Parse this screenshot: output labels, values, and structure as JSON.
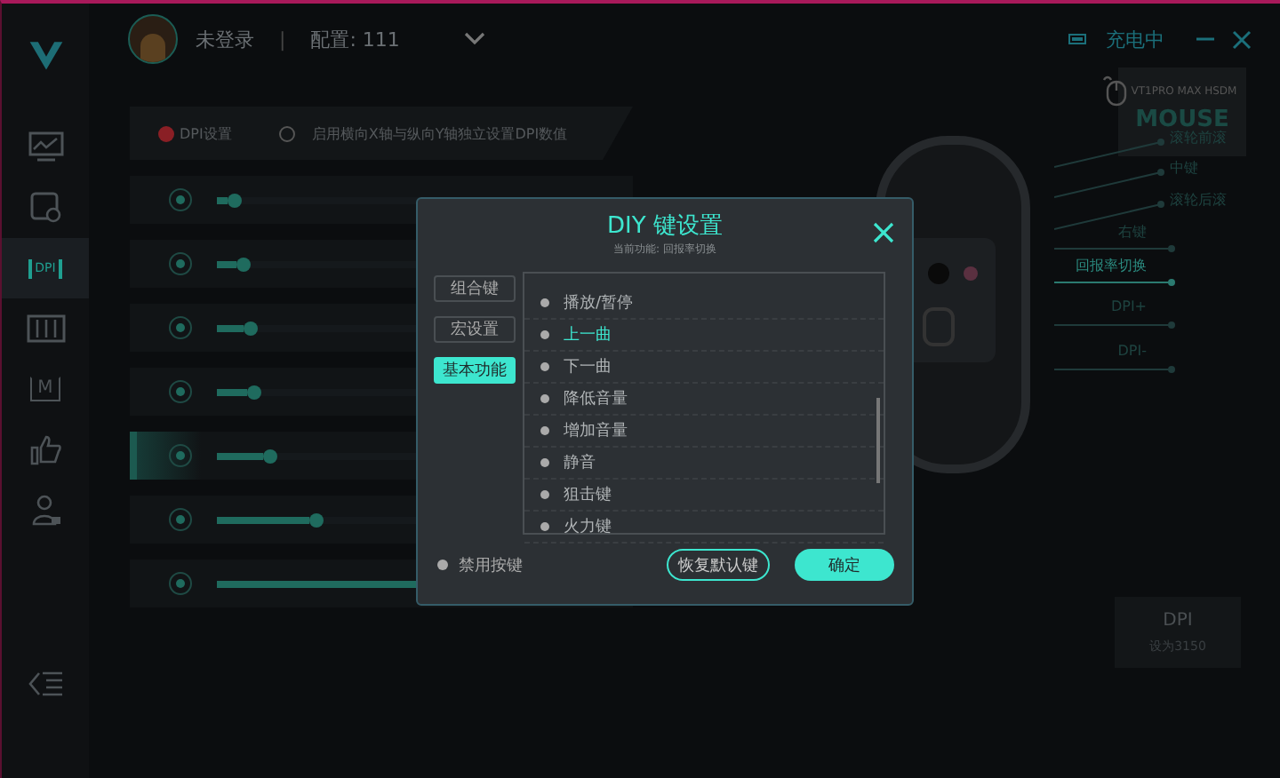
{
  "window": {
    "status": "充电中"
  },
  "sidebar": [
    {
      "kind": "monitor",
      "selected": false
    },
    {
      "kind": "screen-gear",
      "selected": false
    },
    {
      "kind": "dpi",
      "label": "DPI",
      "selected": true
    },
    {
      "kind": "sliders",
      "selected": false
    },
    {
      "kind": "macro",
      "label": "M",
      "selected": false
    },
    {
      "kind": "thumb",
      "selected": false
    },
    {
      "kind": "user",
      "selected": false
    }
  ],
  "user": {
    "name": "未登录",
    "separator": "|",
    "profile": "配置: 111"
  },
  "dpi_panel": {
    "title": "DPI设置",
    "independent_xy": {
      "label": "启用横向X轴与纵向Y轴独立设置DPI数值",
      "checked": false
    },
    "rows": [
      {
        "level": 0.03,
        "selected": false
      },
      {
        "level": 0.05,
        "selected": false
      },
      {
        "level": 0.07,
        "selected": false
      },
      {
        "level": 0.08,
        "selected": false
      },
      {
        "level": 0.12,
        "selected": true
      },
      {
        "level": 0.24,
        "selected": false
      },
      {
        "level": 1,
        "selected": false
      }
    ]
  },
  "device": {
    "model": "VT1PRO MAX HSDM",
    "name": "MOUSE"
  },
  "button_map": [
    {
      "label": "滚轮前滚",
      "selected": false
    },
    {
      "label": "中键",
      "selected": false
    },
    {
      "label": "滚轮后滚",
      "selected": false
    },
    {
      "label": "右键",
      "selected": false
    },
    {
      "label": "回报率切换",
      "selected": true
    },
    {
      "label": "DPI+",
      "selected": false
    },
    {
      "label": "DPI-",
      "selected": false
    }
  ],
  "dpi_card": {
    "title": "DPI",
    "value": "设为3150"
  },
  "dialog": {
    "title": "DIY 键设置",
    "subtitle": "当前功能: 回报率切换",
    "tabs": [
      {
        "label": "组合键",
        "selected": false
      },
      {
        "label": "宏设置",
        "selected": false
      },
      {
        "label": "基本功能",
        "selected": true
      }
    ],
    "functions": [
      {
        "label": "播放/暂停",
        "selected": false
      },
      {
        "label": "上一曲",
        "selected": true
      },
      {
        "label": "下一曲",
        "selected": false
      },
      {
        "label": "降低音量",
        "selected": false
      },
      {
        "label": "增加音量",
        "selected": false
      },
      {
        "label": "静音",
        "selected": false
      },
      {
        "label": "狙击键",
        "selected": false
      },
      {
        "label": "火力键",
        "selected": false
      }
    ],
    "disable_key": {
      "label": "禁用按键",
      "checked": false
    },
    "buttons": [
      "恢复默认键",
      "确定"
    ]
  }
}
